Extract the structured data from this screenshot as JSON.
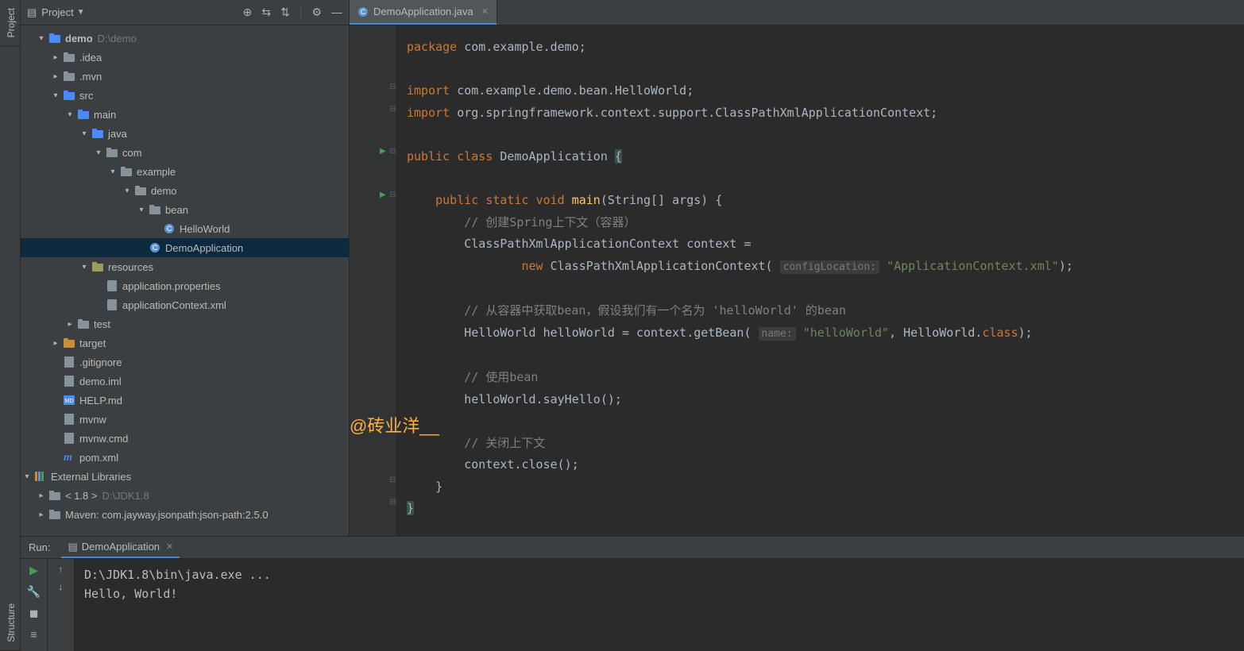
{
  "leftRail": {
    "project": "Project",
    "structure": "Structure"
  },
  "project": {
    "title": "Project",
    "root": {
      "name": "demo",
      "path": "D:\\demo"
    },
    "tree": [
      {
        "depth": 0,
        "arrow": "down",
        "icon": "folder-blue",
        "label": "demo",
        "labelBold": true,
        "suffix": "D:\\demo"
      },
      {
        "depth": 1,
        "arrow": "right",
        "icon": "folder",
        "label": ".idea"
      },
      {
        "depth": 1,
        "arrow": "right",
        "icon": "folder",
        "label": ".mvn"
      },
      {
        "depth": 1,
        "arrow": "down",
        "icon": "folder-blue",
        "label": "src"
      },
      {
        "depth": 2,
        "arrow": "down",
        "icon": "folder-blue",
        "label": "main"
      },
      {
        "depth": 3,
        "arrow": "down",
        "icon": "folder-blue",
        "label": "java"
      },
      {
        "depth": 4,
        "arrow": "down",
        "icon": "folder",
        "label": "com"
      },
      {
        "depth": 5,
        "arrow": "down",
        "icon": "folder",
        "label": "example"
      },
      {
        "depth": 6,
        "arrow": "down",
        "icon": "folder",
        "label": "demo"
      },
      {
        "depth": 7,
        "arrow": "down",
        "icon": "folder",
        "label": "bean"
      },
      {
        "depth": 8,
        "arrow": "",
        "icon": "class",
        "label": "HelloWorld"
      },
      {
        "depth": 7,
        "arrow": "",
        "icon": "class",
        "label": "DemoApplication",
        "selected": true
      },
      {
        "depth": 3,
        "arrow": "down",
        "icon": "folder-res",
        "label": "resources"
      },
      {
        "depth": 4,
        "arrow": "",
        "icon": "file",
        "label": "application.properties"
      },
      {
        "depth": 4,
        "arrow": "",
        "icon": "file",
        "label": "applicationContext.xml"
      },
      {
        "depth": 2,
        "arrow": "right",
        "icon": "folder",
        "label": "test"
      },
      {
        "depth": 1,
        "arrow": "right",
        "icon": "folder-orange",
        "label": "target"
      },
      {
        "depth": 1,
        "arrow": "",
        "icon": "file",
        "label": ".gitignore"
      },
      {
        "depth": 1,
        "arrow": "",
        "icon": "file",
        "label": "demo.iml"
      },
      {
        "depth": 1,
        "arrow": "",
        "icon": "file-md",
        "label": "HELP.md"
      },
      {
        "depth": 1,
        "arrow": "",
        "icon": "file",
        "label": "mvnw"
      },
      {
        "depth": 1,
        "arrow": "",
        "icon": "file",
        "label": "mvnw.cmd"
      },
      {
        "depth": 1,
        "arrow": "",
        "icon": "file-m",
        "label": "pom.xml"
      },
      {
        "depth": -1,
        "arrow": "down",
        "icon": "lib",
        "label": "External Libraries"
      },
      {
        "depth": 0,
        "arrow": "right",
        "icon": "folder",
        "label": "< 1.8 >",
        "suffix": "D:\\JDK1.8"
      },
      {
        "depth": 0,
        "arrow": "right",
        "icon": "folder",
        "label": "Maven: com.jayway.jsonpath:json-path:2.5.0"
      }
    ]
  },
  "editor": {
    "tab": {
      "name": "DemoApplication.java"
    },
    "watermark": "@砖业洋__",
    "code": {
      "l1_kw": "package",
      "l1_pkg": "com.example.demo",
      "l3_kw": "import",
      "l3_val": "com.example.demo.bean.HelloWorld",
      "l4_kw": "import",
      "l4_val": "org.springframework.context.support.ClassPathXmlApplicationContext",
      "l6_a": "public",
      "l6_b": "class",
      "l6_c": "DemoApplication",
      "l8_a": "public",
      "l8_b": "static",
      "l8_c": "void",
      "l8_d": "main",
      "l8_e": "(String[] args) {",
      "l9": "// 创建Spring上下文（容器）",
      "l10_a": "ClassPathXmlApplicationContext context =",
      "l11_kw": "new",
      "l11_a": "ClassPathXmlApplicationContext(",
      "l11_hint": "configLocation:",
      "l11_str": "\"ApplicationContext.xml\"",
      "l11_end": ");",
      "l13": "// 从容器中获取bean，假设我们有一个名为 'helloWorld' 的bean",
      "l14_a": "HelloWorld helloWorld = context.getBean(",
      "l14_hint": "name:",
      "l14_str": "\"helloWorld\"",
      "l14_b": ", HelloWorld.",
      "l14_kw": "class",
      "l14_end": ");",
      "l16": "// 使用bean",
      "l17": "helloWorld.sayHello();",
      "l19": "// 关闭上下文",
      "l20": "context.close();"
    }
  },
  "run": {
    "label": "Run:",
    "config": "DemoApplication",
    "console": {
      "line1": "D:\\JDK1.8\\bin\\java.exe ...",
      "line2": "Hello, World!"
    }
  }
}
